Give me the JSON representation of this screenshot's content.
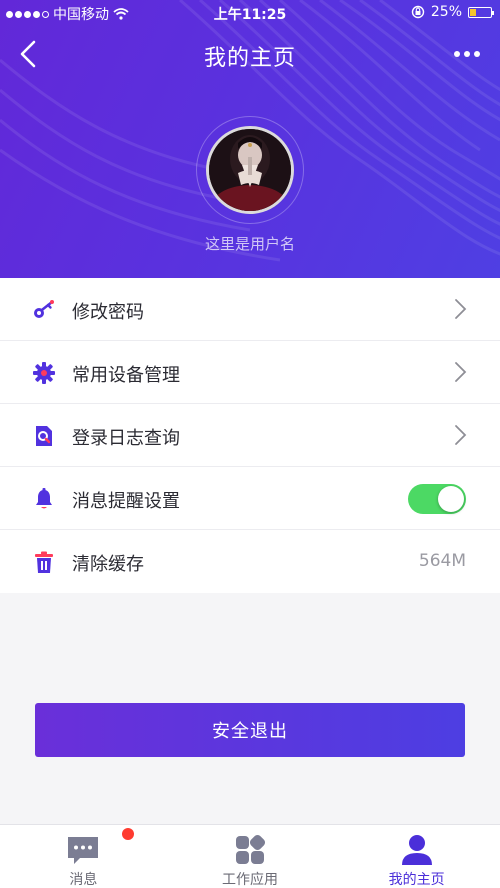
{
  "status_bar": {
    "carrier": "中国移动",
    "time": "上午11:25",
    "battery": "25%"
  },
  "header": {
    "title": "我的主页",
    "username": "这里是用户名"
  },
  "menu": {
    "change_password": "修改密码",
    "device_management": "常用设备管理",
    "login_log": "登录日志查询",
    "notification_settings": "消息提醒设置",
    "notifications_enabled": true,
    "clear_cache": "清除缓存",
    "cache_size": "564M"
  },
  "logout_label": "安全退出",
  "tabs": {
    "messages": "消息",
    "work_apps": "工作应用",
    "my_page": "我的主页"
  },
  "colors": {
    "accent": "#5132df",
    "toggle_on": "#4cd964",
    "badge": "#ff3b30"
  },
  "icons": {
    "menu": [
      "key-icon",
      "gear-icon",
      "search-document-icon",
      "bell-icon",
      "trash-icon"
    ],
    "tabs": [
      "chat-bubble-icon",
      "app-grid-icon",
      "user-icon"
    ]
  }
}
